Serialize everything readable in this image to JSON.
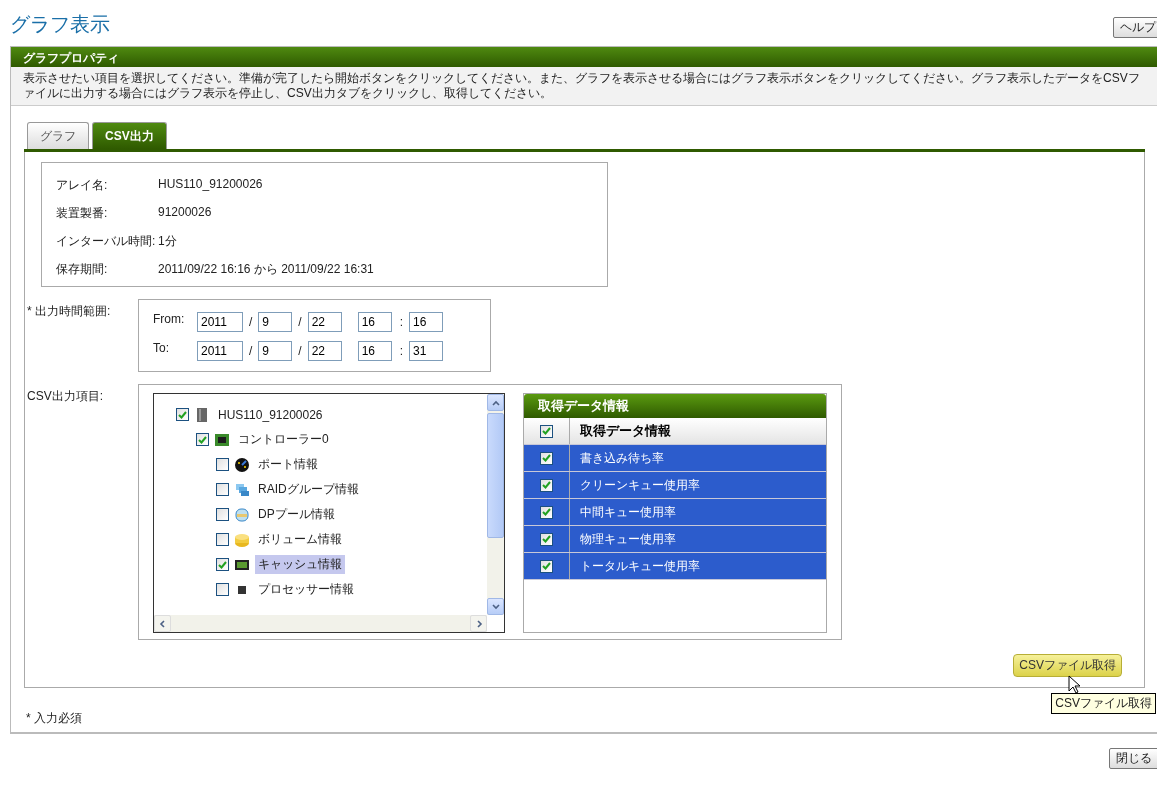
{
  "page": {
    "title": "グラフ表示",
    "help_button": "ヘルプ"
  },
  "panel": {
    "title": "グラフプロパティ",
    "description": "表示させたい項目を選択してください。準備が完了したら開始ボタンをクリックしてください。また、グラフを表示させる場合にはグラフ表示ボタンをクリックしてください。グラフ表示したデータをCSVファイルに出力する場合にはグラフ表示を停止し、CSV出力タブをクリックし、取得してください。"
  },
  "tabs": [
    {
      "label": "グラフ",
      "selected": false
    },
    {
      "label": "CSV出力",
      "selected": true
    }
  ],
  "info": [
    {
      "label": "アレイ名:",
      "value": "HUS110_91200026"
    },
    {
      "label": "装置製番:",
      "value": "91200026"
    },
    {
      "label": "インターバル時間:",
      "value": "1分"
    },
    {
      "label": "保存期間:",
      "value": "2011/09/22 16:16 から 2011/09/22 16:31"
    }
  ],
  "time_range": {
    "label": "* 出力時間範囲:",
    "rows": [
      {
        "label": "From:",
        "year": "2011",
        "month": "9",
        "day": "22",
        "hour": "16",
        "minute": "16"
      },
      {
        "label": "To:",
        "year": "2011",
        "month": "9",
        "day": "22",
        "hour": "16",
        "minute": "31"
      }
    ],
    "date_sep": "/",
    "time_sep": ":"
  },
  "csv_items": {
    "label": "CSV出力項目:",
    "tree": [
      {
        "label": "HUS110_91200026",
        "kind": "array",
        "checked": true,
        "selected": false,
        "children": [
          {
            "label": "コントローラー0",
            "kind": "controller",
            "checked": true,
            "selected": false,
            "children": [
              {
                "label": "ポート情報",
                "kind": "port",
                "checked": false,
                "selected": false
              },
              {
                "label": "RAIDグループ情報",
                "kind": "raid",
                "checked": false,
                "selected": false
              },
              {
                "label": "DPプール情報",
                "kind": "pool",
                "checked": false,
                "selected": false
              },
              {
                "label": "ボリューム情報",
                "kind": "volume",
                "checked": false,
                "selected": false
              },
              {
                "label": "キャッシュ情報",
                "kind": "cache",
                "checked": true,
                "selected": true
              },
              {
                "label": "プロセッサー情報",
                "kind": "processor",
                "checked": false,
                "selected": false
              }
            ]
          }
        ]
      }
    ]
  },
  "data_table": {
    "title": "取得データ情報",
    "header": {
      "label": "取得データ情報",
      "checked": true
    },
    "rows": [
      {
        "label": "書き込み待ち率",
        "checked": true,
        "selected": true
      },
      {
        "label": "クリーンキュー使用率",
        "checked": true,
        "selected": true
      },
      {
        "label": "中間キュー使用率",
        "checked": true,
        "selected": true
      },
      {
        "label": "物理キュー使用率",
        "checked": true,
        "selected": true
      },
      {
        "label": "トータルキュー使用率",
        "checked": true,
        "selected": true
      }
    ]
  },
  "csv_button": {
    "label": "CSVファイル取得",
    "tooltip": "CSVファイル取得"
  },
  "required_note": "* 入力必須",
  "close_button": "閉じる"
}
